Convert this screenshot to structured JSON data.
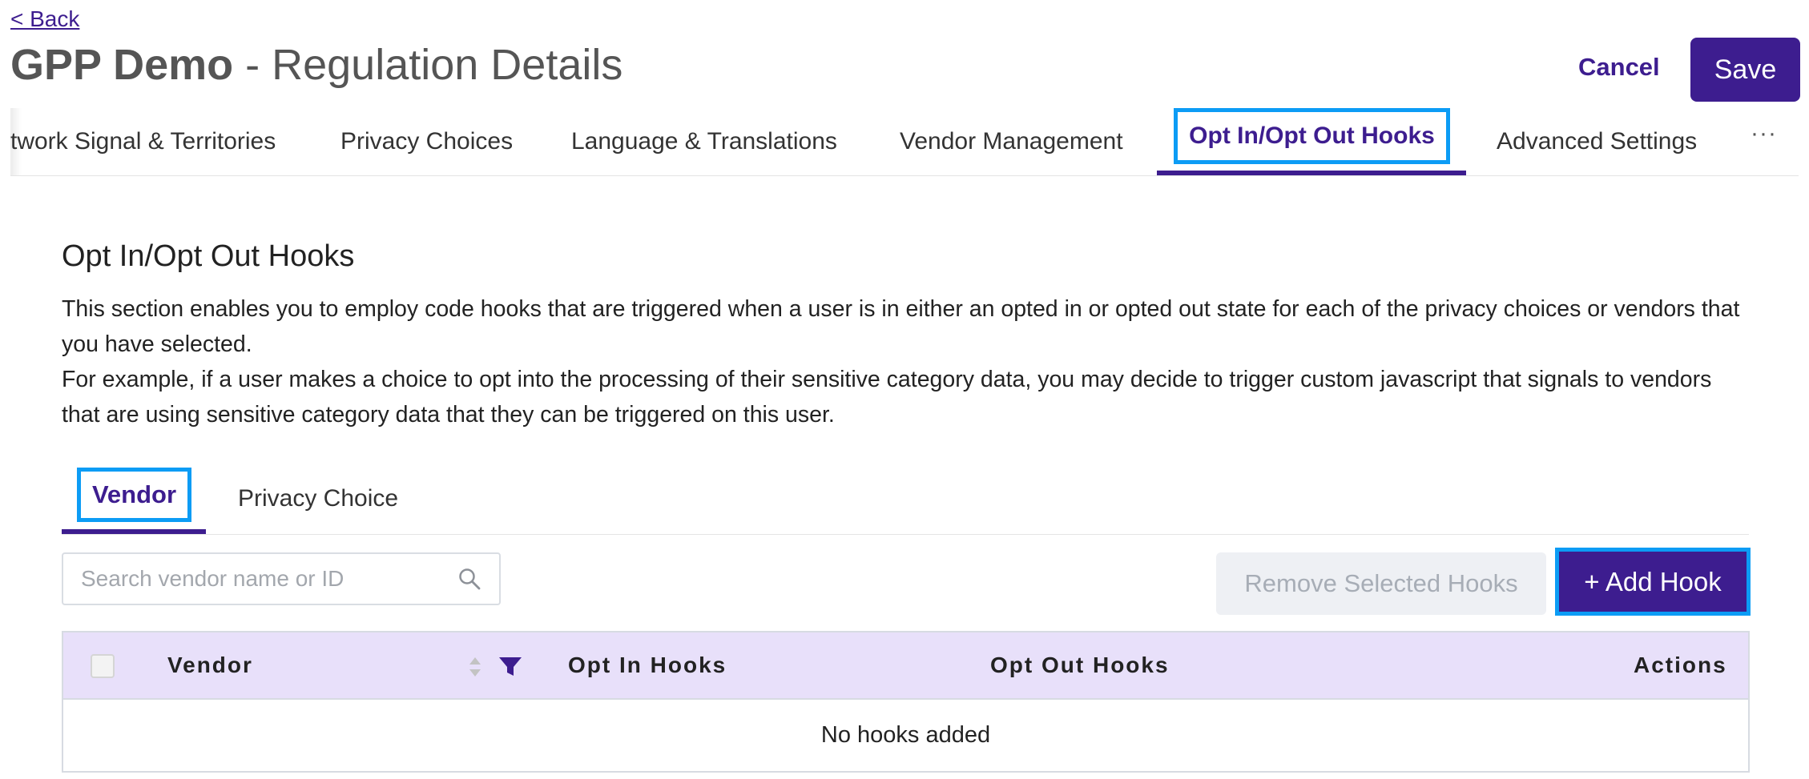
{
  "header": {
    "back_label": "< Back",
    "title_bold": "GPP Demo",
    "title_separator": " - ",
    "title_rest": "Regulation Details",
    "cancel_label": "Cancel",
    "save_label": "Save"
  },
  "tabs": {
    "items": [
      {
        "label": "twork Signal & Territories"
      },
      {
        "label": "Privacy Choices"
      },
      {
        "label": "Language & Translations"
      },
      {
        "label": "Vendor Management"
      },
      {
        "label": "Opt In/Opt Out Hooks",
        "active": true
      },
      {
        "label": "Advanced Settings"
      }
    ],
    "more_label": "···"
  },
  "section": {
    "title": "Opt In/Opt Out Hooks",
    "description_1": "This section enables you to employ code hooks that are triggered when a user is in either an opted in or opted out state for each of the privacy choices or vendors that you have selected.",
    "description_2": "For example, if a user makes a choice to opt into the processing of their sensitive category data, you may decide to trigger custom javascript that signals to vendors that are using sensitive category data that they can be triggered on this user."
  },
  "subtabs": {
    "vendor_label": "Vendor",
    "privacy_choice_label": "Privacy Choice"
  },
  "search": {
    "placeholder": "Search vendor name or ID",
    "value": "",
    "icon": "search-icon"
  },
  "actions": {
    "remove_label": "Remove Selected Hooks",
    "add_label": "+ Add Hook"
  },
  "table": {
    "columns": [
      "Vendor",
      "Opt In Hooks",
      "Opt Out Hooks",
      "Actions"
    ],
    "empty_message": "No hooks added"
  },
  "colors": {
    "primary": "#3d1d8f",
    "highlight": "#0c9cf5",
    "table_header_bg": "#e8e0fa",
    "disabled_bg": "#eef0f4"
  }
}
